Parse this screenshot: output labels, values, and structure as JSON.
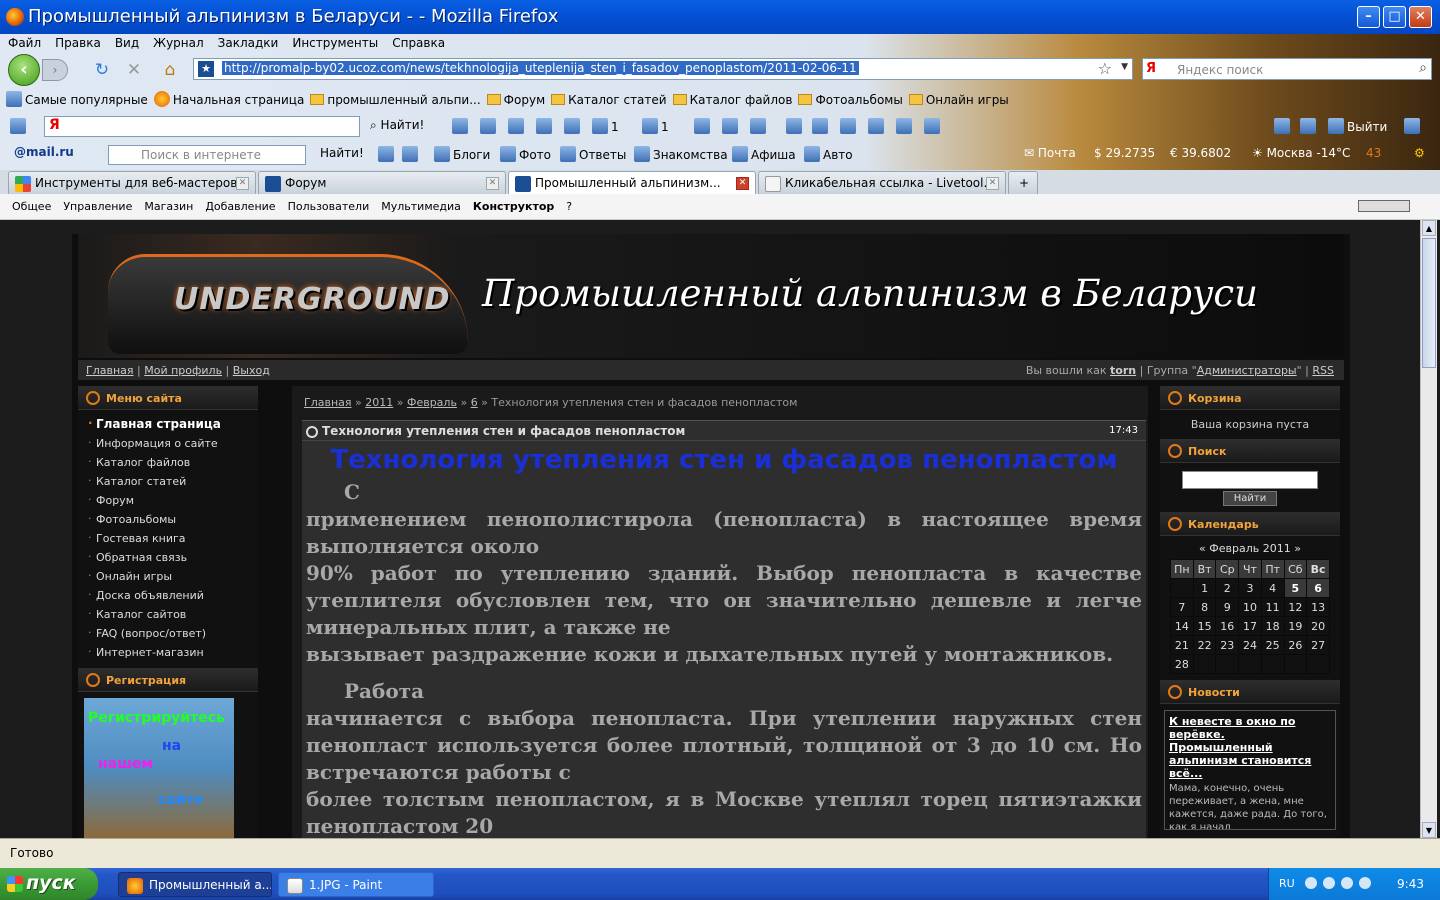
{
  "window": {
    "title": "Промышленный альпинизм в Беларуси - - Mozilla Firefox"
  },
  "menu": [
    "Файл",
    "Правка",
    "Вид",
    "Журнал",
    "Закладки",
    "Инструменты",
    "Справка"
  ],
  "nav": {
    "url": "http://promalp-by02.ucoz.com/news/tekhnologija_uteplenija_sten_i_fasadov_penoplastom/2011-02-06-11",
    "search_placeholder": "Яндекс поиск",
    "search_engine": "Я"
  },
  "bookmarks": [
    "Самые популярные",
    "Начальная страница",
    "промышленный альпи...",
    "Форум",
    "Каталог статей",
    "Каталог файлов",
    "Фотоальбомы",
    "Онлайн игры"
  ],
  "toolbar1": {
    "ya": "Я",
    "find": "Найти!",
    "count1": "1",
    "count2": "1",
    "exit": "Выйти"
  },
  "toolbar2": {
    "mail": "@mail.ru",
    "placeholder": "Поиск в интернете",
    "find": "Найти!",
    "links": [
      "Блоги",
      "Фото",
      "Ответы",
      "Знакомства",
      "Афиша",
      "Авто"
    ],
    "post": "Почта",
    "usd": "29.2735",
    "eur": "39.6802",
    "weather": "Москва -14°C",
    "badge": "43"
  },
  "tabs": [
    "Инструменты для веб-мастеров...",
    "Форум",
    "Промышленный альпинизм...",
    "Кликабельная ссылка - Livetool..."
  ],
  "admin": [
    "Общее",
    "Управление",
    "Магазин",
    "Добавление",
    "Пользователи",
    "Мультимедиа",
    "Конструктор",
    "?"
  ],
  "site": {
    "title": "Промышленный альпинизм в Беларуси",
    "logo": "UNDERGROUND",
    "userbar_left": [
      "Главная",
      "Мой профиль",
      "Выход"
    ],
    "userbar_right": {
      "prefix": "Вы вошли как",
      "user": "torn",
      "group_prefix": "Группа \"",
      "group": "Администраторы",
      "group_suffix": "\"",
      "rss": "RSS"
    }
  },
  "left": {
    "menu_title": "Меню сайта",
    "items": [
      "Главная страница",
      "Информация о сайте",
      "Каталог файлов",
      "Каталог статей",
      "Форум",
      "Фотоальбомы",
      "Гостевая книга",
      "Обратная связь",
      "Онлайн игры",
      "Доска объявлений",
      "Каталог сайтов",
      "FAQ (вопрос/ответ)",
      "Интернет-магазин"
    ],
    "reg_title": "Регистрация",
    "reg_words": [
      "Регистрируйтесь",
      "на",
      "нашем",
      "сайте"
    ]
  },
  "main": {
    "crumbs": [
      "Главная",
      "2011",
      "Февраль",
      "6",
      "Технология утепления стен и фасадов пенопластом"
    ],
    "head": "Технология утепления стен и фасадов пенопластом",
    "time": "17:43",
    "h1": "Технология утепления стен и фасадов пенопластом",
    "p": [
      "С",
      "применением пенополистирола (пенопласта) в настоящее время выполняется около",
      "90% работ по утеплению зданий. Выбор пенопласта в качестве утеплителя обусловлен тем, что он значительно дешевле и легче минеральных плит, а также не",
      "вызывает раздражение кожи и дыхательных путей у монтажников.",
      "Работа",
      "начинается с выбора пенопласта. При утеплении наружных стен пенопласт используется более плотный, толщиной от 3 до 10 см. Но встречаются работы с",
      "более толстым пенопластом, я в Москве утеплял торец пятиэтажки пенопластом 20"
    ]
  },
  "right": {
    "cart_title": "Корзина",
    "cart_text": "Ваша корзина пуста",
    "search_title": "Поиск",
    "search_btn": "Найти",
    "cal_title": "Календарь",
    "cal_month": "Февраль 2011",
    "cal_prev": "«",
    "cal_next": "»",
    "cal_days": [
      "Пн",
      "Вт",
      "Ср",
      "Чт",
      "Пт",
      "Сб",
      "Вс"
    ],
    "cal_rows": [
      [
        "",
        "1",
        "2",
        "3",
        "4",
        "5",
        "6"
      ],
      [
        "7",
        "8",
        "9",
        "10",
        "11",
        "12",
        "13"
      ],
      [
        "14",
        "15",
        "16",
        "17",
        "18",
        "19",
        "20"
      ],
      [
        "21",
        "22",
        "23",
        "24",
        "25",
        "26",
        "27"
      ],
      [
        "28",
        "",
        "",
        "",
        "",
        "",
        ""
      ]
    ],
    "news_title": "Новости",
    "news_link": "К невесте в окно по верёвке. Промышленный альпинизм становится всё...",
    "news_text": "Мама, конечно, очень переживает, а жена, мне кажется, даже рада. До того, как я начал"
  },
  "status": "Готово",
  "taskbar": {
    "start": "пуск",
    "tasks": [
      "Промышленный а...",
      "1.JPG - Paint"
    ],
    "lang": "RU",
    "clock": "9:43"
  },
  "colors": {
    "accent": "#e07a18",
    "title_blue": "#1a2fd6"
  }
}
